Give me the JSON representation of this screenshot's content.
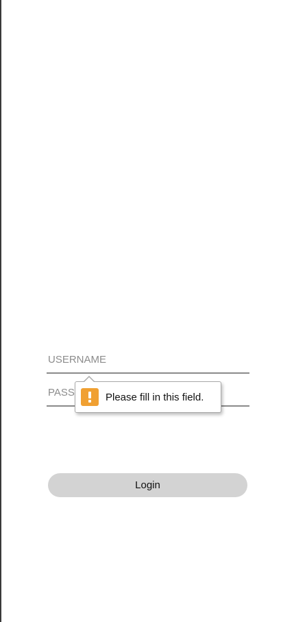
{
  "login_form": {
    "username_placeholder": "USERNAME",
    "password_placeholder": "PASSWORD",
    "login_label": "Login"
  },
  "validation_tooltip": {
    "message": "Please fill in this field.",
    "icon": "warning-icon",
    "icon_color": "#f0a032"
  }
}
